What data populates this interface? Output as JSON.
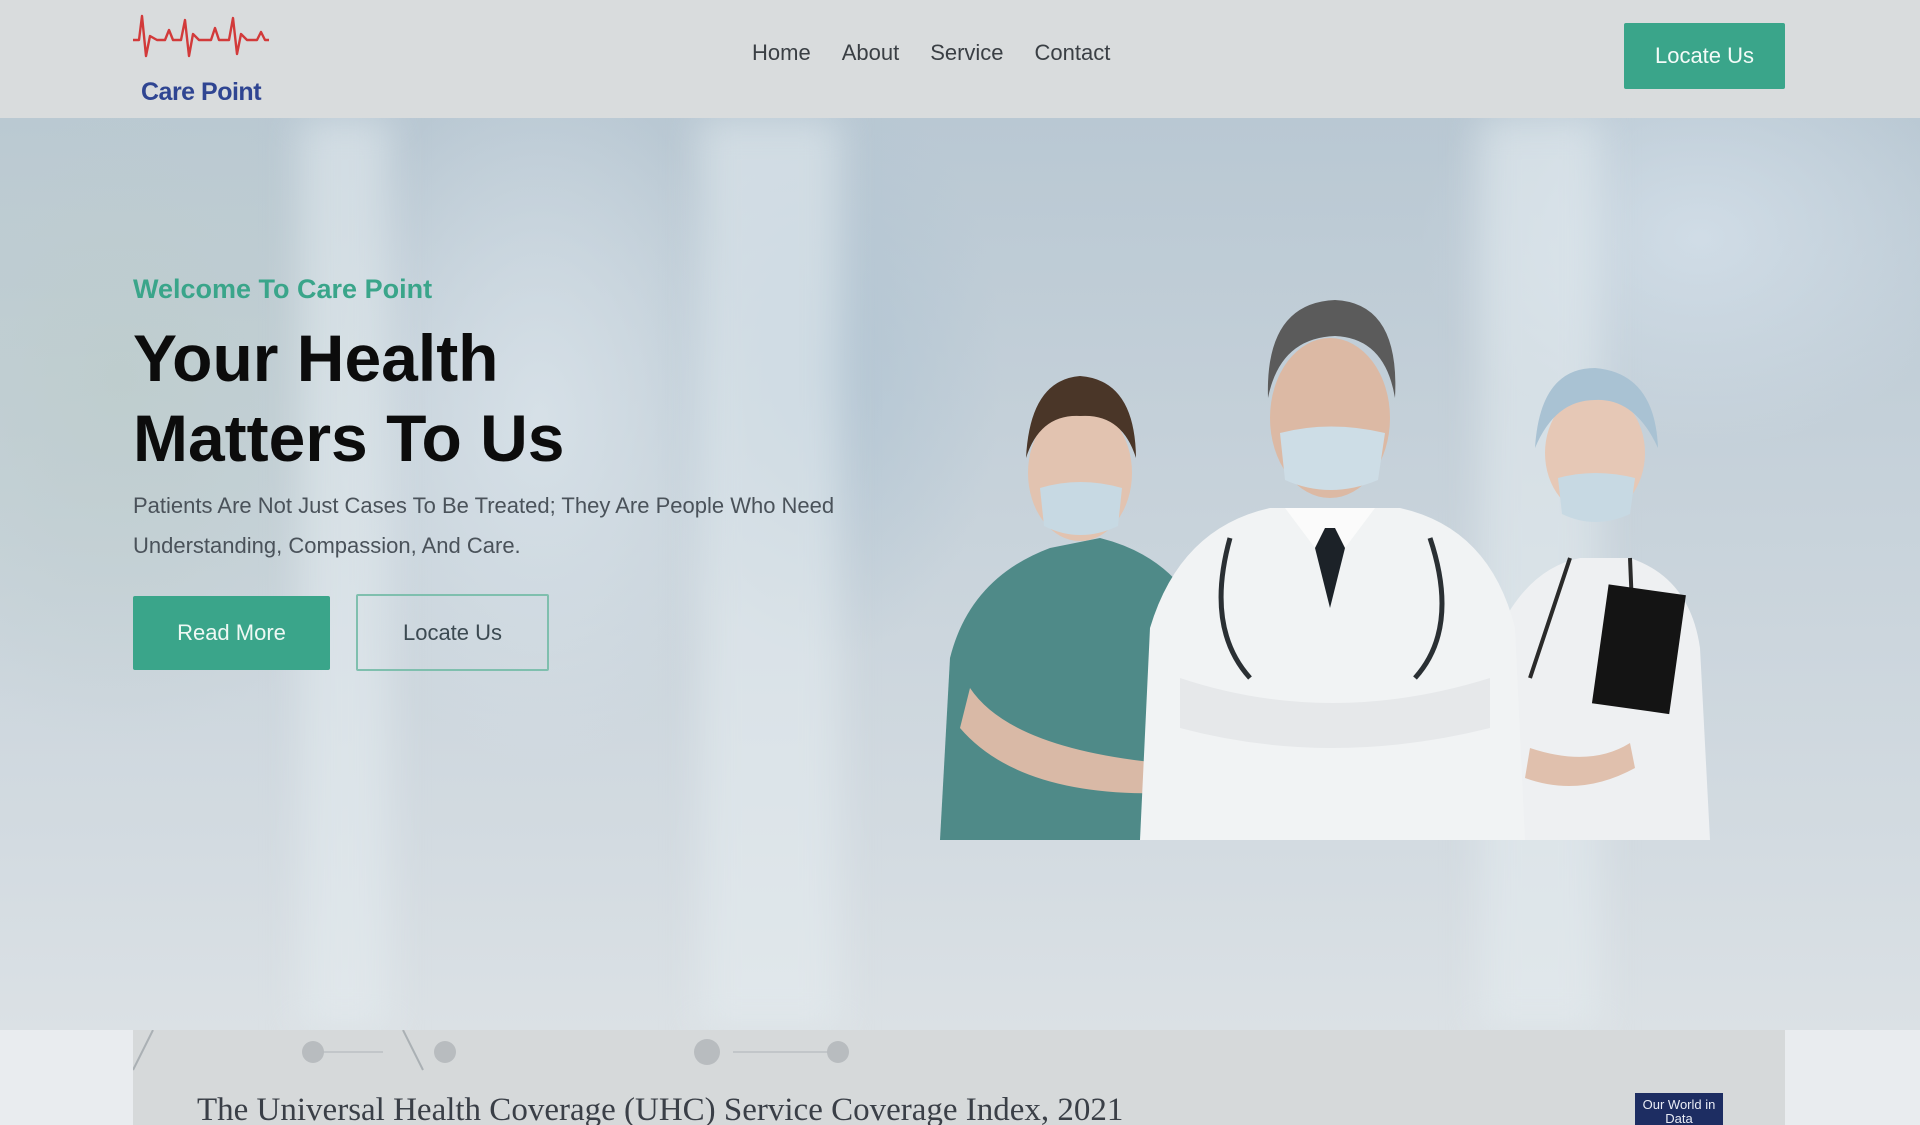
{
  "header": {
    "logo_text": "Care Point",
    "nav": [
      "Home",
      "About",
      "Service",
      "Contact"
    ],
    "cta": "Locate Us"
  },
  "hero": {
    "welcome": "Welcome To Care Point",
    "headline_line1": "Your Health",
    "headline_line2": "Matters To Us",
    "subtitle": "Patients Are Not Just Cases To Be Treated; They Are People Who Need Understanding, Compassion, And Care.",
    "read_more": "Read More",
    "locate": "Locate Us"
  },
  "card": {
    "title": "The Universal Health Coverage (UHC) Service Coverage Index, 2021",
    "badge": "Our World in Data"
  },
  "colors": {
    "accent": "#3aa58a",
    "logo_blue": "#2f4592",
    "logo_pulse": "#d23a3a"
  },
  "icons": [
    "heartbeat-logo-icon"
  ]
}
